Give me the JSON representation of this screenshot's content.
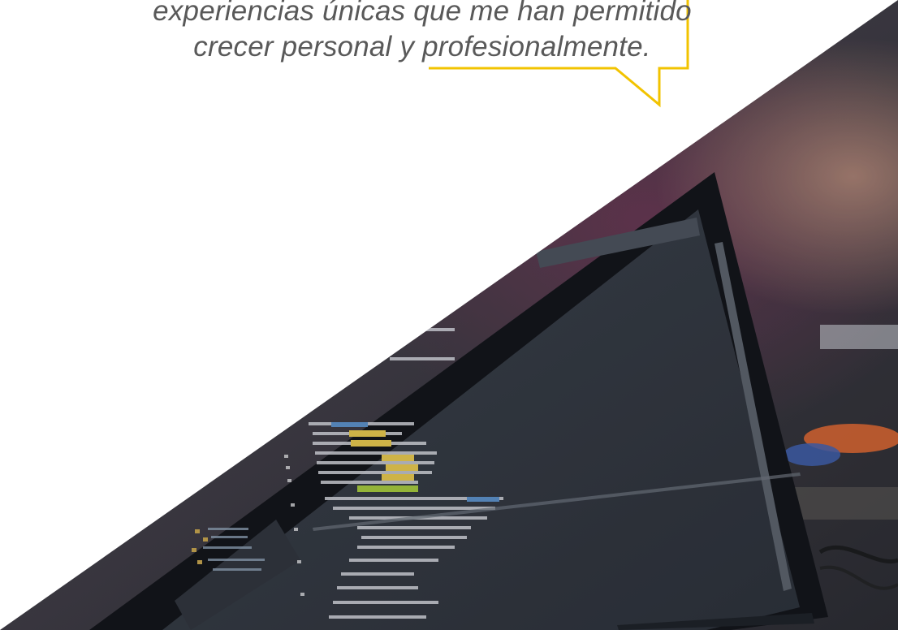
{
  "quote": {
    "line_1": "experiencias únicas que me han permitido",
    "line_2": "crecer personal y profesionalmente."
  },
  "colors": {
    "quote_text": "#595959",
    "bubble_outline": "#f2c300",
    "background": "#ffffff",
    "photo_overlay": "#1c2330"
  },
  "icons": {
    "speech_bubble": "speech-bubble-outline",
    "photo": "laptop-code-photo"
  }
}
